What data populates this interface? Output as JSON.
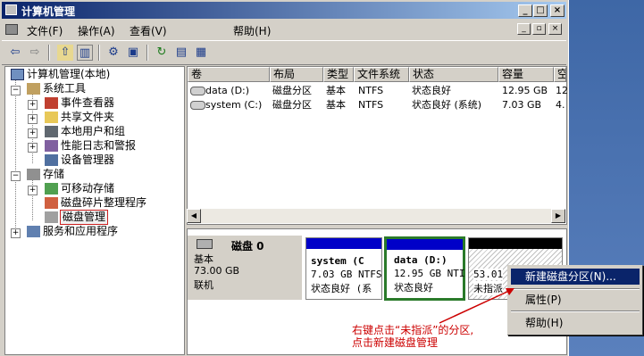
{
  "window": {
    "title": "计算机管理"
  },
  "menu": [
    "文件(F)",
    "操作(A)",
    "查看(V)",
    "帮助(H)"
  ],
  "tree": [
    {
      "label": "计算机管理(本地)"
    },
    {
      "label": "系统工具"
    },
    {
      "label": "事件查看器"
    },
    {
      "label": "共享文件夹"
    },
    {
      "label": "本地用户和组"
    },
    {
      "label": "性能日志和警报"
    },
    {
      "label": "设备管理器"
    },
    {
      "label": "存储"
    },
    {
      "label": "可移动存储"
    },
    {
      "label": "磁盘碎片整理程序"
    },
    {
      "label": "磁盘管理"
    },
    {
      "label": "服务和应用程序"
    }
  ],
  "list": {
    "headers": [
      "卷",
      "布局",
      "类型",
      "文件系统",
      "状态",
      "容量",
      "空"
    ],
    "rows": [
      [
        "data (D:)",
        "磁盘分区",
        "基本",
        "NTFS",
        "状态良好",
        "12.95 GB",
        "12"
      ],
      [
        "system (C:)",
        "磁盘分区",
        "基本",
        "NTFS",
        "状态良好 (系统)",
        "7.03 GB",
        "4."
      ]
    ]
  },
  "disk": {
    "name": "磁盘 0",
    "type": "基本",
    "size": "73.00 GB",
    "status": "联机"
  },
  "partitions": [
    {
      "name": "system (C",
      "size": "7.03 GB NTFS",
      "status": "状态良好 (系"
    },
    {
      "name": "data (D:)",
      "size": "12.95 GB NTI",
      "status": "状态良好"
    },
    {
      "name": "",
      "size": "53.01",
      "status": "未指派"
    }
  ],
  "context_menu": {
    "new_partition": "新建磁盘分区(N)...",
    "properties": "属性(P)",
    "help": "帮助(H)"
  },
  "annotation": {
    "line1": "右键点击“未指派”的分区,",
    "line2": "点击新建磁盘管理"
  },
  "colors": {
    "title_start": "#0a246a",
    "title_end": "#a6caf0",
    "partition_bar": "#0000c8",
    "unalloc_bar": "#000000",
    "selection_border": "#2a7a2a",
    "annotation": "#cc0000"
  }
}
